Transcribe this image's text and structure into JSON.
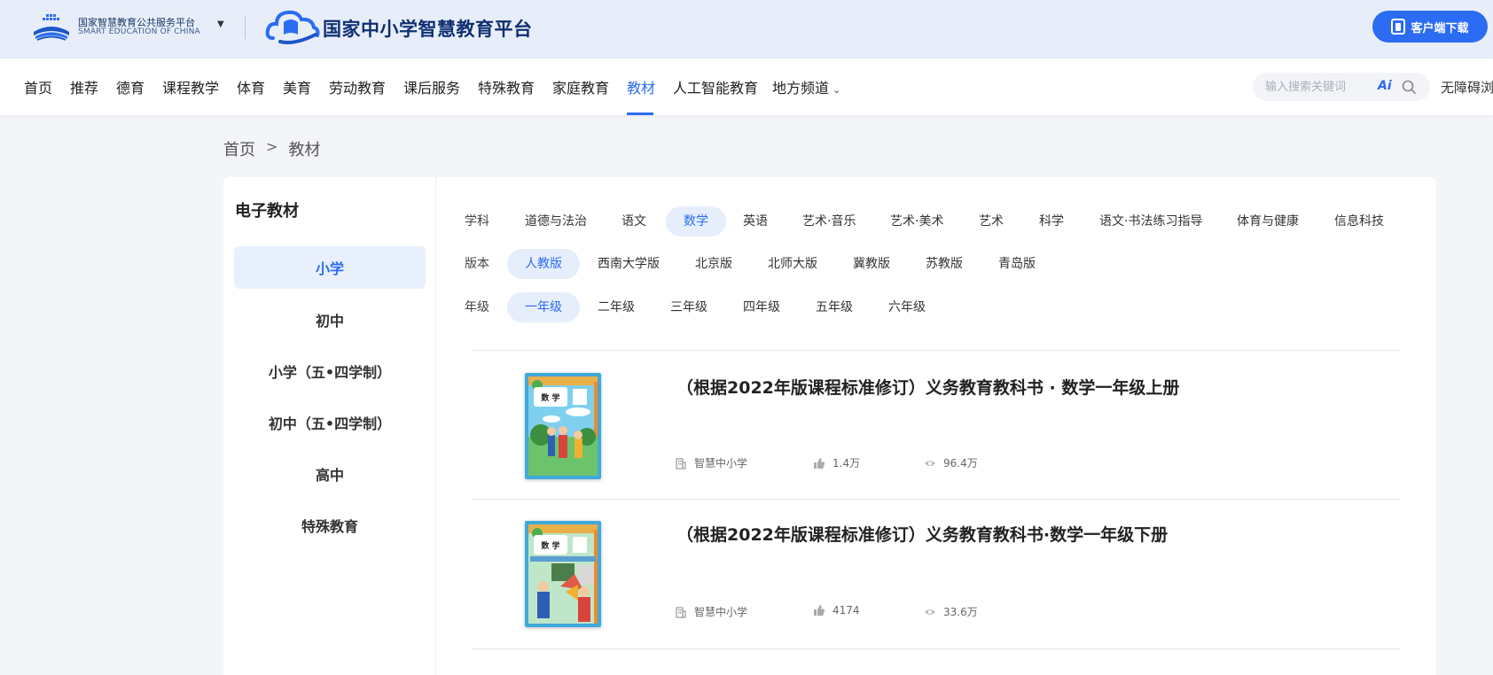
{
  "header": {
    "brand_cn": "国家智慧教育公共服务平台",
    "brand_en": "SMART EDUCATION OF CHINA",
    "platform_title": "国家中小学智慧教育平台",
    "download_label": "客户端下载"
  },
  "nav": {
    "items": [
      "首页",
      "推荐",
      "德育",
      "课程教学",
      "体育",
      "美育",
      "劳动教育",
      "课后服务",
      "特殊教育",
      "家庭教育",
      "教材",
      "人工智能教育",
      "地方频道"
    ],
    "active": "教材",
    "search_placeholder": "输入搜索关键词",
    "ai_label": "Ai",
    "accessibility": "无障碍浏览"
  },
  "breadcrumb": {
    "home": "首页",
    "separator": ">",
    "current": "教材"
  },
  "sidebar": {
    "title": "电子教材",
    "items": [
      "小学",
      "初中",
      "小学（五•四学制）",
      "初中（五•四学制）",
      "高中",
      "特殊教育"
    ],
    "active": "小学"
  },
  "filters": {
    "subject": {
      "label": "学科",
      "options": [
        "道德与法治",
        "语文",
        "数学",
        "英语",
        "艺术·音乐",
        "艺术·美术",
        "艺术",
        "科学",
        "语文·书法练习指导",
        "体育与健康",
        "信息科技"
      ],
      "selected": "数学"
    },
    "edition": {
      "label": "版本",
      "options": [
        "人教版",
        "西南大学版",
        "北京版",
        "北师大版",
        "冀教版",
        "苏教版",
        "青岛版"
      ],
      "selected": "人教版"
    },
    "grade": {
      "label": "年级",
      "options": [
        "一年级",
        "二年级",
        "三年级",
        "四年级",
        "五年级",
        "六年级"
      ],
      "selected": "一年级"
    }
  },
  "books": [
    {
      "title": "（根据2022年版课程标准修订）义务教育教科书 · 数学一年级上册",
      "source": "智慧中小学",
      "likes": "1.4万",
      "views": "96.4万",
      "cover_text": "数 学"
    },
    {
      "title": "（根据2022年版课程标准修订）义务教育教科书·数学一年级下册",
      "source": "智慧中小学",
      "likes": "4174",
      "views": "33.6万",
      "cover_text": "数 学"
    }
  ],
  "colors": {
    "accent": "#2b6cf2",
    "header_bg": "#e8eef9",
    "page_bg": "#f3f5f9"
  }
}
